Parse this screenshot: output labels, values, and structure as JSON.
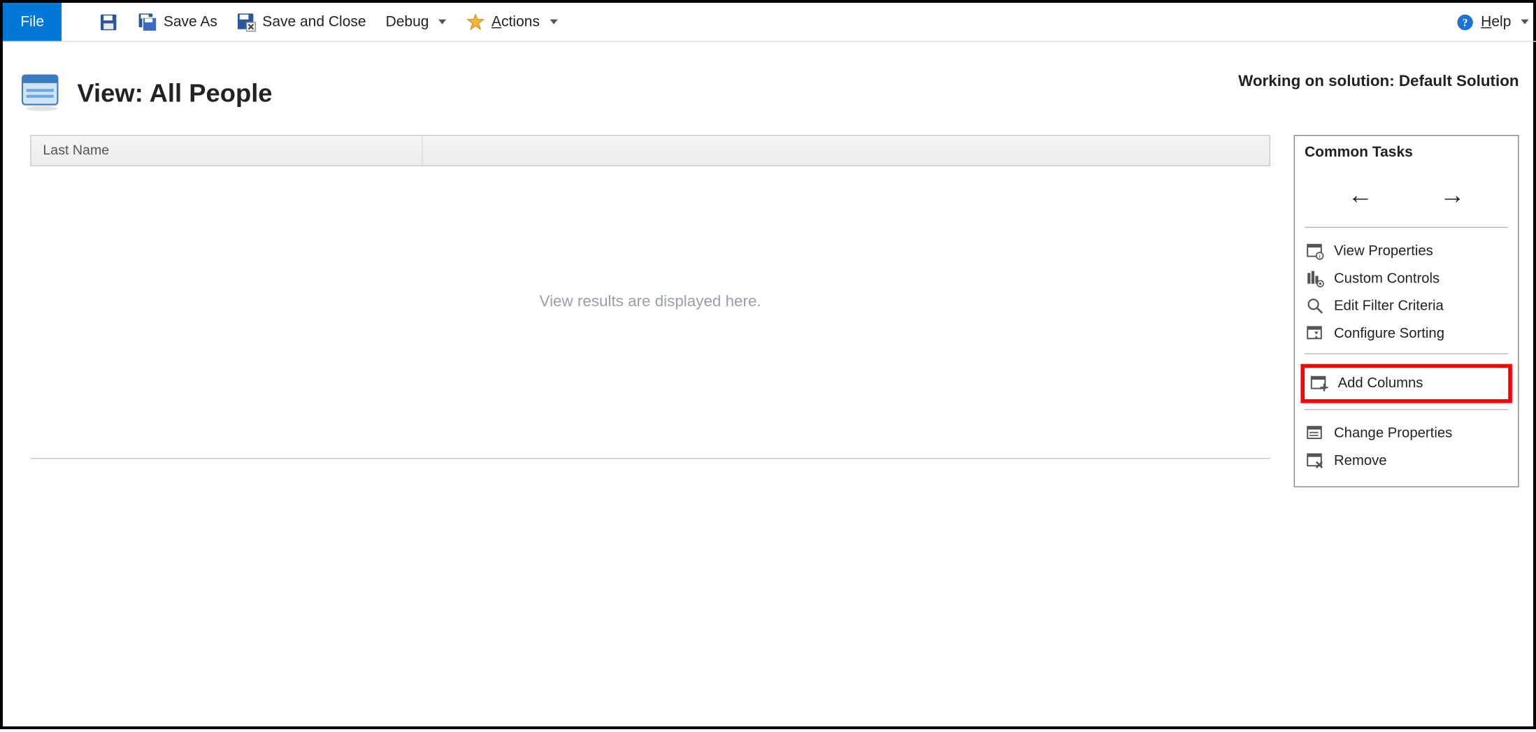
{
  "toolbar": {
    "file": "File",
    "save_as": "Save As",
    "save_close": "Save and Close",
    "debug": "Debug",
    "actions": "Actions",
    "help": "Help"
  },
  "header": {
    "title": "View: All People",
    "solution": "Working on solution: Default Solution"
  },
  "grid": {
    "columns": [
      "Last Name",
      ""
    ],
    "placeholder": "View results are displayed here."
  },
  "tasks": {
    "title": "Common Tasks",
    "view_properties": "View Properties",
    "custom_controls": "Custom Controls",
    "edit_filter": "Edit Filter Criteria",
    "configure_sorting": "Configure Sorting",
    "add_columns": "Add Columns",
    "change_properties": "Change Properties",
    "remove": "Remove"
  }
}
